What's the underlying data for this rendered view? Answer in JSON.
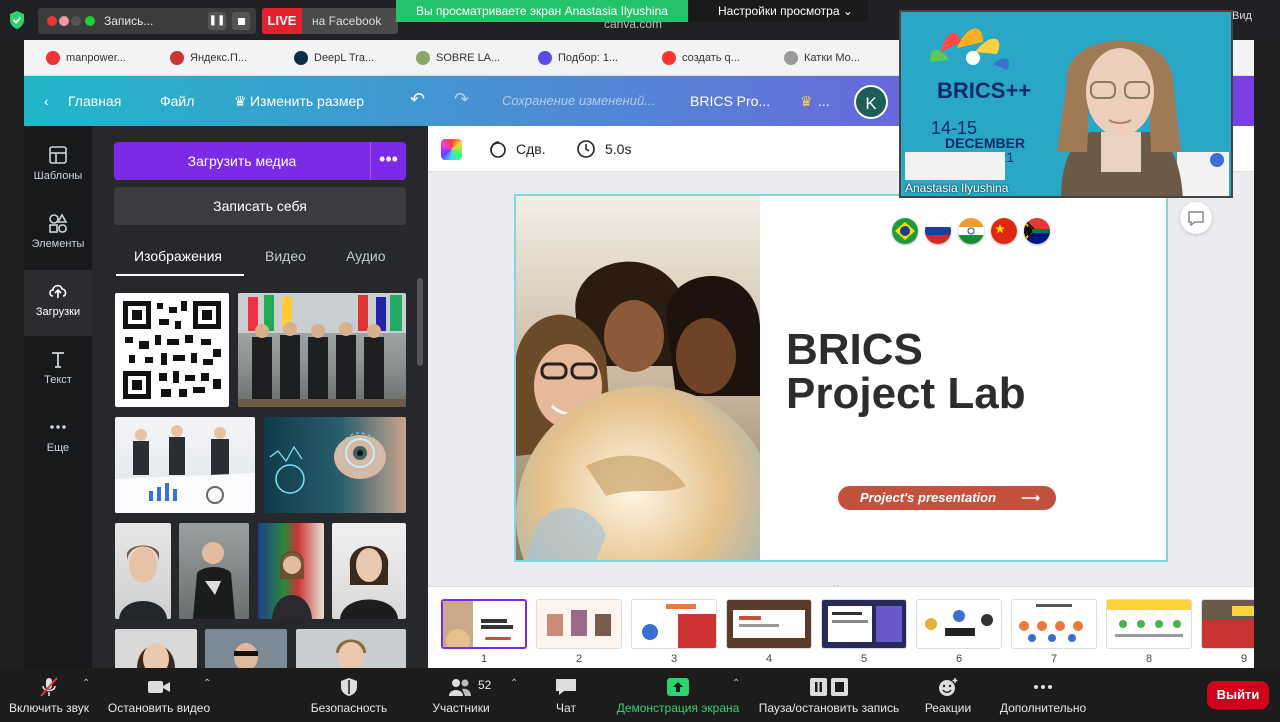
{
  "zoom_top": {
    "recording_label": "Запись...",
    "live_tag": "LIVE",
    "live_target": "на Facebook",
    "viewing_banner": "Вы просматриваете экран Anastasia Ilyushina",
    "view_settings": "Настройки просмотра",
    "url": "canva.com",
    "view_label": "Вид"
  },
  "bookmarks": [
    "manpower...",
    "Яндекс.П...",
    "DeepL Tra...",
    "SOBRE LA...",
    "Подбор: 1...",
    "создать q...",
    "Катки Мо..."
  ],
  "canva_header": {
    "home": "Главная",
    "file": "Файл",
    "resize": "Изменить размер",
    "saving": "Сохранение изменений...",
    "doc_title": "BRICS Pro...",
    "avatar_letter": "K",
    "crown_more": "..."
  },
  "rail": [
    {
      "label": "Шаблоны"
    },
    {
      "label": "Элементы"
    },
    {
      "label": "Загрузки"
    },
    {
      "label": "Текст"
    },
    {
      "label": "Еще"
    }
  ],
  "panel": {
    "upload_media": "Загрузить медиа",
    "more": "•••",
    "record_self": "Записать себя",
    "tabs": [
      "Изображения",
      "Видео",
      "Аудио"
    ]
  },
  "editor_toolbar": {
    "animate": "Сдв.",
    "duration": "5.0s"
  },
  "slide": {
    "title_line1": "BRICS",
    "title_line2": "Project Lab",
    "button": "Project's presentation"
  },
  "pages": [
    "1",
    "2",
    "3",
    "4",
    "5",
    "6",
    "7",
    "8",
    "9"
  ],
  "webcam": {
    "participant": "Anastasia Ilyushina",
    "dates": "14-15",
    "month": "DECEMBER",
    "year": "2021",
    "logo": "BRICS++"
  },
  "zoom_bar": {
    "unmute": "Включить звук",
    "stop_video": "Остановить видео",
    "security": "Безопасность",
    "participants": "Участники",
    "participants_count": "52",
    "chat": "Чат",
    "share": "Демонстрация экрана",
    "pause_rec": "Пауза/остановить запись",
    "reactions": "Реакции",
    "more": "Дополнительно",
    "leave": "Выйти"
  },
  "colors": {
    "canva_purple": "#7d2ae8",
    "slide_button": "#c4513e",
    "leave_red": "#d0021b",
    "share_green": "#2dd36f"
  }
}
